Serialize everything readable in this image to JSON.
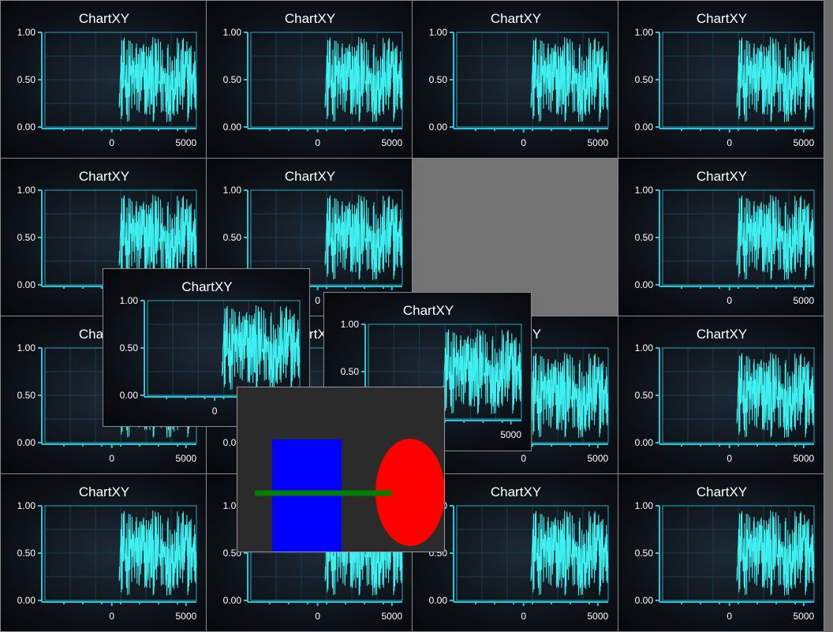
{
  "colors": {
    "background": "#6e6e6e",
    "trace": "#3ff0f0",
    "axis": "#27c4dc",
    "shape_rect": "#0000ff",
    "shape_ellipse": "#ff0000",
    "shape_line": "#008000"
  },
  "chart_template": {
    "title": "ChartXY",
    "y_ticks": [
      "1.00",
      "0.50",
      "0.00"
    ],
    "x_ticks": [
      "0",
      "5000"
    ]
  },
  "chart_data": {
    "type": "line",
    "title": "ChartXY",
    "xlabel": "",
    "ylabel": "",
    "xlim": [
      -4500,
      5700
    ],
    "ylim": [
      0,
      1
    ],
    "x_ticks": [
      0,
      5000
    ],
    "y_ticks": [
      0,
      0.5,
      1
    ],
    "series": [
      {
        "x_start": 500,
        "x_end": 5700,
        "y_min": 0.0,
        "y_max": 1.0,
        "description": "dense random noise"
      }
    ]
  }
}
